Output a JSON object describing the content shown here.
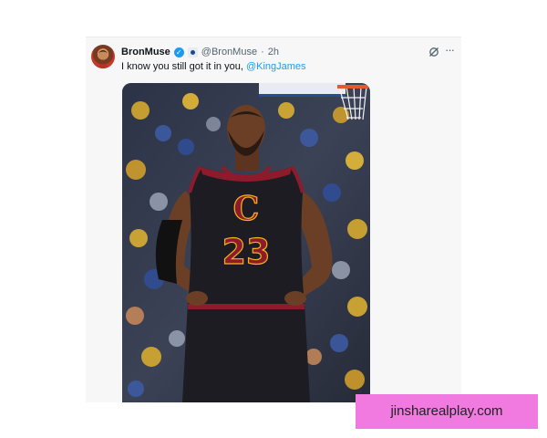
{
  "tweet": {
    "display_name": "BronMuse",
    "handle": "@BronMuse",
    "separator": "·",
    "time": "2h",
    "text_prefix": "I know you still got it in you, ",
    "mention": "@KingJames",
    "jersey_number": "23",
    "jersey_logo": "C"
  },
  "icons": {
    "verified": "verified-badge-icon",
    "affiliate": "affiliate-badge-icon",
    "grok": "grok-icon",
    "more": "more-options-icon"
  },
  "colors": {
    "link": "#1d9bf0",
    "verified": "#1d9bf0",
    "watermark_bg": "#f07ae0",
    "jersey": "#1c1c22",
    "jersey_trim": "#8e1b2b",
    "jersey_gold": "#f5b31b"
  },
  "watermark": "jinsharealplay.com"
}
